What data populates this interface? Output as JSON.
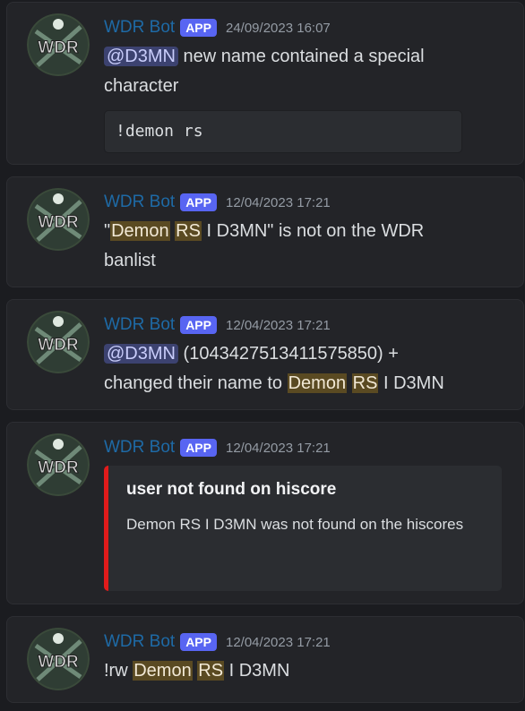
{
  "messages": [
    {
      "author": "WDR Bot",
      "badge": "APP",
      "time": "24/09/2023 16:07",
      "mention": "@D3MN",
      "line1_rest": " new name contained a special",
      "line2": "character",
      "code": "!demon rs"
    },
    {
      "author": "WDR Bot",
      "badge": "APP",
      "time": "12/04/2023 17:21",
      "part1": "\"",
      "hl1": "Demon",
      "hl2": "RS",
      "part2": " I D3MN\" is not on the WDR",
      "line2": "banlist"
    },
    {
      "author": "WDR Bot",
      "badge": "APP",
      "time": "12/04/2023 17:21",
      "mention": "@D3MN",
      "part1": " (1043427513411575850) +",
      "part2": "changed their name to ",
      "hl1": "Demon",
      "hl2": "RS",
      "part3": " I D3MN"
    },
    {
      "author": "WDR Bot",
      "badge": "APP",
      "time": "12/04/2023 17:21",
      "embed_title": "user not found on hiscore",
      "embed_desc": "Demon RS I D3MN was not found on the hiscores"
    },
    {
      "author": "WDR Bot",
      "badge": "APP",
      "time": "12/04/2023 17:21",
      "part1": "!rw ",
      "hl1": "Demon",
      "hl2": "RS",
      "part2": " I D3MN"
    }
  ],
  "avatar_text": "WDR",
  "colors": {
    "author": "#1e6aa6",
    "badge": "#5865f2",
    "embed_bar": "#e11b1b",
    "highlight": "#5a4a22"
  }
}
